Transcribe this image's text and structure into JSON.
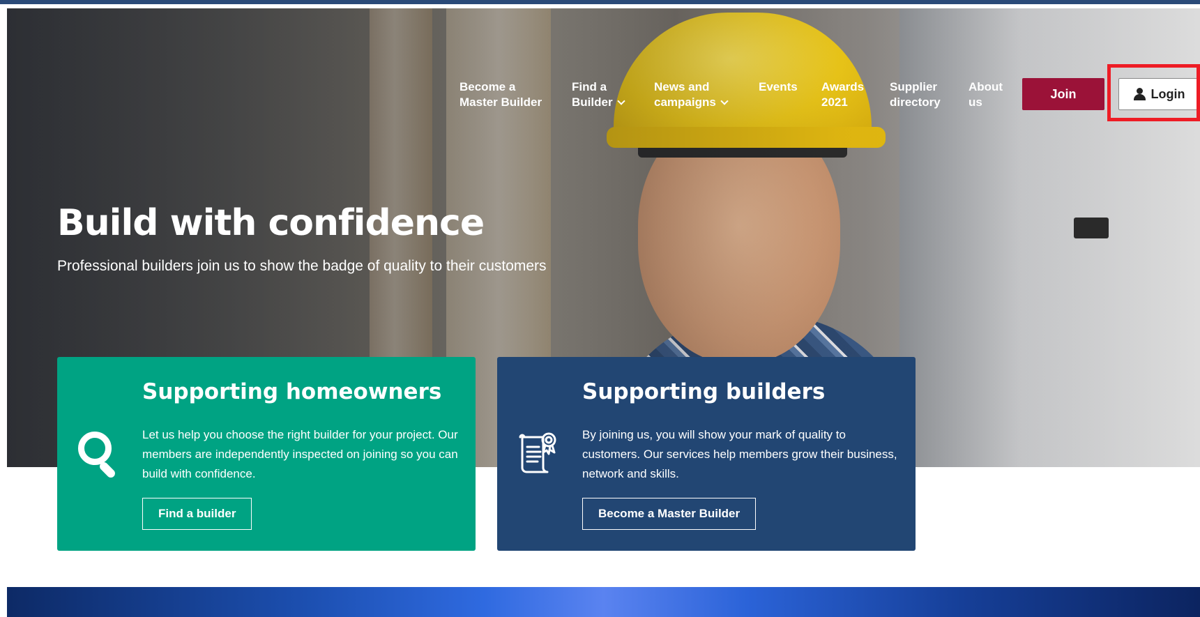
{
  "colors": {
    "join": "#9b1238",
    "green_card": "#00a383",
    "blue_card": "#224673",
    "highlight": "#ee1c25"
  },
  "nav": {
    "become": {
      "line1": "Become a",
      "line2": "Master Builder"
    },
    "find": {
      "line1": "Find a",
      "line2": "Builder"
    },
    "news": {
      "line1": "News and",
      "line2": "campaigns"
    },
    "events": {
      "line1": "Events"
    },
    "awards": {
      "line1": "Awards",
      "line2": "2021"
    },
    "supplier": {
      "line1": "Supplier",
      "line2": "directory"
    },
    "about": {
      "line1": "About",
      "line2": "us"
    },
    "join_label": "Join",
    "login_label": "Login"
  },
  "hero": {
    "title": "Build with confidence",
    "subtitle": "Professional builders join us to show the badge of quality to their customers"
  },
  "cards": [
    {
      "title": "Supporting homeowners",
      "text": "Let us help you choose the right builder for your project. Our members are independently inspected on joining so you can build with confidence.",
      "button": "Find a builder",
      "icon": "search-icon"
    },
    {
      "title": "Supporting builders",
      "text": "By joining us, you will show your mark of quality to customers. Our services help members grow their business, network and skills.",
      "button": "Become a Master Builder",
      "icon": "certificate-icon"
    }
  ]
}
